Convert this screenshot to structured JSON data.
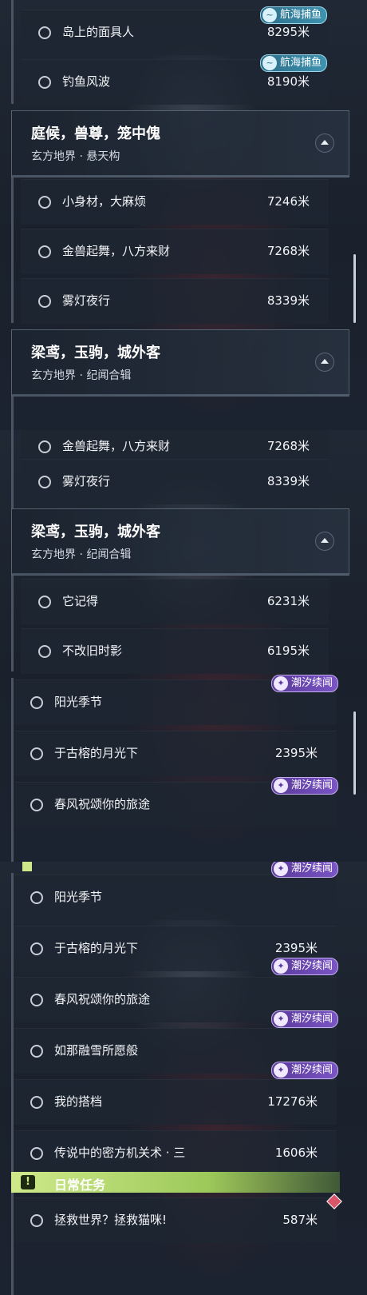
{
  "panel1": {
    "rows_top": [
      {
        "title": "岛上的面具人",
        "distance": "8295米",
        "badge": "航海捕鱼"
      },
      {
        "title": "钓鱼风波",
        "distance": "8190米",
        "badge": "航海捕鱼"
      }
    ],
    "group1": {
      "title": "庭候，兽尊，笼中傀",
      "subtitle": "玄方地界 · 悬天构"
    },
    "rows_mid": [
      {
        "title": "小身材，大麻烦",
        "distance": "7246米"
      },
      {
        "title": "金兽起舞，八方来财",
        "distance": "7268米"
      },
      {
        "title": "雾灯夜行",
        "distance": "8339米"
      }
    ],
    "group2": {
      "title": "梁鸢，玉驹，城外客",
      "subtitle": "玄方地界 · 纪闻合辑"
    }
  },
  "panel2": {
    "rows_top": [
      {
        "title": "金兽起舞，八方来财",
        "distance": "7268米"
      },
      {
        "title": "雾灯夜行",
        "distance": "8339米"
      }
    ],
    "group": {
      "title": "梁鸢，玉驹，城外客",
      "subtitle": "玄方地界 · 纪闻合辑"
    },
    "rows_mid": [
      {
        "title": "它记得",
        "distance": "6231米"
      },
      {
        "title": "不改旧时影",
        "distance": "6195米"
      }
    ],
    "rows_bottom": [
      {
        "title": "阳光季节",
        "distance": "",
        "badge": "潮汐续闻"
      },
      {
        "title": "于古榕的月光下",
        "distance": "2395米"
      },
      {
        "title": "春风祝颂你的旅途",
        "distance": "",
        "badge": "潮汐续闻"
      }
    ]
  },
  "panel3": {
    "rows": [
      {
        "title": "阳光季节",
        "distance": "",
        "badge": "潮汐续闻"
      },
      {
        "title": "于古榕的月光下",
        "distance": "2395米"
      },
      {
        "title": "春风祝颂你的旅途",
        "distance": "",
        "badge": "潮汐续闻"
      },
      {
        "title": "如那融雪所愿般",
        "distance": "",
        "badge": "潮汐续闻"
      },
      {
        "title": "我的搭档",
        "distance": "17276米",
        "badge": "潮汐续闻"
      },
      {
        "title": "传说中的密方机关术 · 三",
        "distance": "1606米"
      }
    ],
    "daily": {
      "label": "日常任务",
      "icon": "!"
    },
    "daily_row": {
      "title": "拯救世界？拯救猫咪!",
      "distance": "587米"
    }
  },
  "icons": {
    "fish_badge": "fish-icon",
    "tide_badge": "tide-icon",
    "collapse": "chevron-up-icon",
    "daily": "exclamation-icon"
  },
  "colors": {
    "fish_badge": "#3e93b0",
    "tide_badge": "#7a55c4",
    "daily_bar": "#9cc95a",
    "diamond": "#d9566a"
  }
}
